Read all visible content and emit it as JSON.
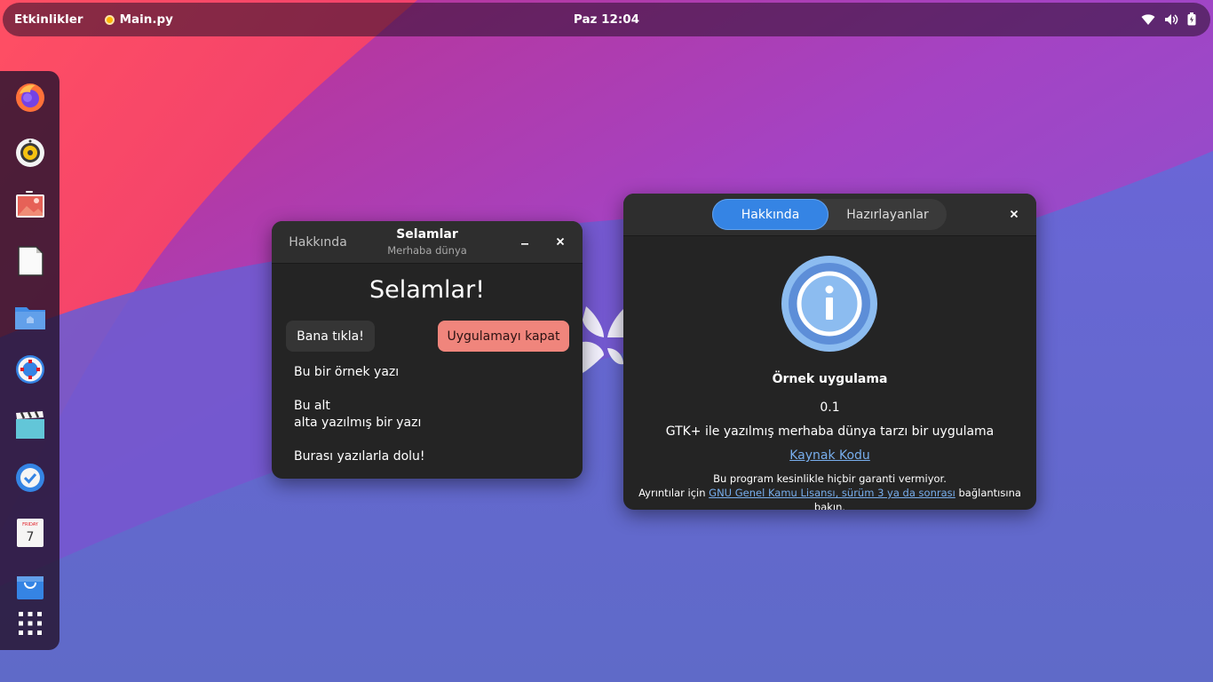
{
  "topbar": {
    "activities": "Etkinlikler",
    "app_name": "Main.py",
    "clock": "Paz 12:04",
    "tray_icons": [
      "wifi-icon",
      "volume-icon",
      "battery-icon"
    ]
  },
  "dock": {
    "items": [
      "firefox-icon",
      "rhythmbox-icon",
      "image-viewer-icon",
      "text-editor-icon",
      "files-icon",
      "help-icon",
      "video-icon",
      "todo-icon",
      "calendar-icon",
      "software-icon",
      "app-grid-icon"
    ],
    "calendar": {
      "day": "FRIDAY",
      "date": "7"
    }
  },
  "window_main": {
    "about_button": "Hakkında",
    "title": "Selamlar",
    "subtitle": "Merhaba dünya",
    "heading": "Selamlar!",
    "click_button": "Bana tıkla!",
    "quit_button": "Uygulamayı kapat",
    "text1": "Bu bir örnek yazı",
    "text2_line1": "Bu alt",
    "text2_line2": "alta yazılmış bir yazı",
    "text3": "Burası yazılarla dolu!"
  },
  "window_about": {
    "tabs": [
      "Hakkında",
      "Hazırlayanlar"
    ],
    "app_name": "Örnek uygulama",
    "version": "0.1",
    "description": "GTK+ ile yazılmış merhaba dünya tarzı bir uygulama",
    "source_link": "Kaynak Kodu",
    "warranty_line": "Bu program kesinlikle hiçbir garanti vermiyor.",
    "license_prefix": "Ayrıntılar için ",
    "license_link": "GNU Genel Kamu Lisansı, sürüm 3 ya da sonrası",
    "license_suffix": " bağlantısına bakın."
  },
  "colors": {
    "accent": "#3584e4",
    "destructive": "#f0857c",
    "window_bg": "#242424",
    "header_bg": "#2e2e2e",
    "link": "#78aeed"
  }
}
